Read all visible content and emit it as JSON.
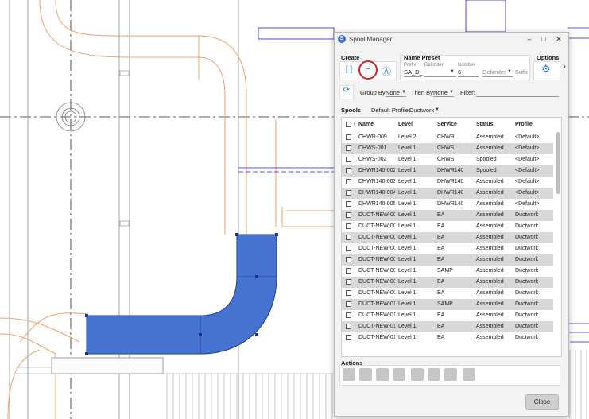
{
  "window": {
    "title": "Spool Manager",
    "app_icon": "spool-manager-icon"
  },
  "create": {
    "header": "Create",
    "buttons": [
      {
        "icon": "bracket-select-icon",
        "glyph": "[ ]"
      },
      {
        "icon": "route-path-icon",
        "glyph": "⌐"
      },
      {
        "icon": "auto-create-icon",
        "glyph": "Ⓐ"
      }
    ]
  },
  "name_preset": {
    "header": "Name Preset",
    "prefix_label": "Prefix",
    "prefix_value": "SA_D_",
    "delimiter_label": "Delimiter",
    "delimiter_value": "-",
    "number_label": "Number",
    "number_value": "6",
    "delimiter2_placeholder": "Delimiter",
    "suffix_placeholder": "Suffix"
  },
  "options": {
    "header": "Options",
    "icon": "gear-icon",
    "next_icon": "chevron-right-icon"
  },
  "toolbar": {
    "refresh_icon": "refresh-icon",
    "group_by_label": "Group By:",
    "group_by_value": "None",
    "then_by_label": "Then By:",
    "then_by_value": "None",
    "filter_label": "Filter:",
    "filter_value": ""
  },
  "spools": {
    "label": "Spools",
    "default_profile_label": "Default Profile:",
    "default_profile_value": "Ductwork",
    "columns": [
      "Name",
      "Level",
      "Service",
      "Status",
      "Profile"
    ],
    "rows": [
      [
        "CHWR-009",
        "Level 2",
        "CHWR",
        "Assembled",
        "<Default>"
      ],
      [
        "CHWS-001",
        "Level 1",
        "CHWS",
        "Assembled",
        "<Default>"
      ],
      [
        "CHWS-002",
        "Level 1",
        "CHWS",
        "Spooled",
        "<Default>"
      ],
      [
        "DHWR140-002",
        "Level 1",
        "DHWR140",
        "Spooled",
        "<Default>"
      ],
      [
        "DHWR140-003",
        "Level 1",
        "DHWR140",
        "Assembled",
        "<Default>"
      ],
      [
        "DHWR140-004",
        "Level 1",
        "DHWR140",
        "Assembled",
        "<Default>"
      ],
      [
        "DHWR140-005",
        "Level 1",
        "DHWR140",
        "Assembled",
        "<Default>"
      ],
      [
        "DUCT-NEW-00",
        "Level 1",
        "EA",
        "Assembled",
        "Ductwork"
      ],
      [
        "DUCT-NEW-00",
        "Level 1",
        "EA",
        "Assembled",
        "Ductwork"
      ],
      [
        "DUCT-NEW-00",
        "Level 1",
        "EA",
        "Assembled",
        "Ductwork"
      ],
      [
        "DUCT-NEW-00",
        "Level 1",
        "EA",
        "Assembled",
        "Ductwork"
      ],
      [
        "DUCT-NEW-00",
        "Level 1",
        "EA",
        "Assembled",
        "Ductwork"
      ],
      [
        "DUCT-NEW-00",
        "Level 1",
        "SAMP",
        "Assembled",
        "Ductwork"
      ],
      [
        "DUCT-NEW-00",
        "Level 1",
        "EA",
        "Assembled",
        "Ductwork"
      ],
      [
        "DUCT-NEW-00",
        "Level 1",
        "EA",
        "Assembled",
        "Ductwork"
      ],
      [
        "DUCT-NEW-01",
        "Level 1",
        "SAMP",
        "Assembled",
        "Ductwork"
      ],
      [
        "DUCT-NEW-01",
        "Level 1",
        "EA",
        "Assembled",
        "Ductwork"
      ],
      [
        "DUCT-NEW-01",
        "Level 1",
        "EA",
        "Assembled",
        "Ductwork"
      ],
      [
        "DUCT-NEW-01",
        "Level 1",
        "EA",
        "Assembled",
        "Ductwork"
      ]
    ]
  },
  "actions": {
    "header": "Actions",
    "icons": [
      "layout-icon",
      "add-to-spool-icon",
      "edit-icon",
      "properties-icon",
      "tag-icon",
      "sheet-icon",
      "delete-icon",
      "export-icon"
    ]
  },
  "close_label": "Close",
  "colors": {
    "duct_fill": "#4673d1",
    "pipe_line": "#f0a06a",
    "accent": "#2d6bd1",
    "highlight_circle": "#d8232a"
  }
}
